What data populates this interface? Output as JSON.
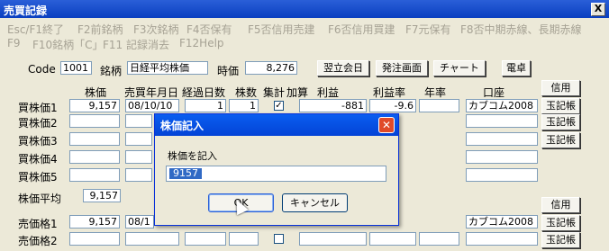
{
  "window": {
    "title": "売買記録",
    "close": "X"
  },
  "menu": [
    "Esc/F1終了",
    "F2前銘柄",
    "F3次銘柄",
    "F4否保有",
    "F5否信用売建",
    "F6否信用買建",
    "F7元保有",
    "F8否中期赤線、長期赤線",
    "F9",
    "F10銘柄「C」",
    "F11 記録消去",
    "F12Help"
  ],
  "top": {
    "code_label": "Code",
    "code_value": "1001",
    "meigara_label": "銘柄",
    "meigara_value": "日経平均株価",
    "jika_label": "時価",
    "jika_value": "8,276",
    "btn_yokukai": "翌立会日",
    "btn_hatchu": "発注画面",
    "btn_chart": "チャート",
    "btn_dentaku": "電卓"
  },
  "headers": {
    "price": "株価",
    "date": "売買年月日",
    "days": "経過日数",
    "shares": "株数",
    "total": "集計",
    "addon": "加算",
    "profit": "利益",
    "rate": "利益率",
    "annual": "年率",
    "account": "口座",
    "credit": "信用"
  },
  "buy_rows": [
    {
      "label": "買株価1",
      "price": "9,157",
      "date": "08/10/10",
      "days": "1",
      "shares": "1",
      "checked": "✓",
      "profit": "-881",
      "rate": "-9.6",
      "account": "カブコム2008",
      "btn": "玉記帳"
    },
    {
      "label": "買株価2",
      "btn": "玉記帳"
    },
    {
      "label": "買株価3",
      "btn": "玉記帳"
    },
    {
      "label": "買株価4"
    },
    {
      "label": "買株価5"
    }
  ],
  "avg": {
    "label": "株価平均",
    "value": "9,157"
  },
  "sell_rows": [
    {
      "label": "売価格1",
      "price": "9,157",
      "date": "08/1",
      "account": "カブコム2008",
      "btn": "玉記帳"
    },
    {
      "label": "売価格2",
      "btn": "玉記帳"
    }
  ],
  "credit2": "信用",
  "dialog": {
    "title": "株価記入",
    "prompt": "株価を記入",
    "value": "9157",
    "ok": "OK",
    "cancel": "キャンセル"
  }
}
